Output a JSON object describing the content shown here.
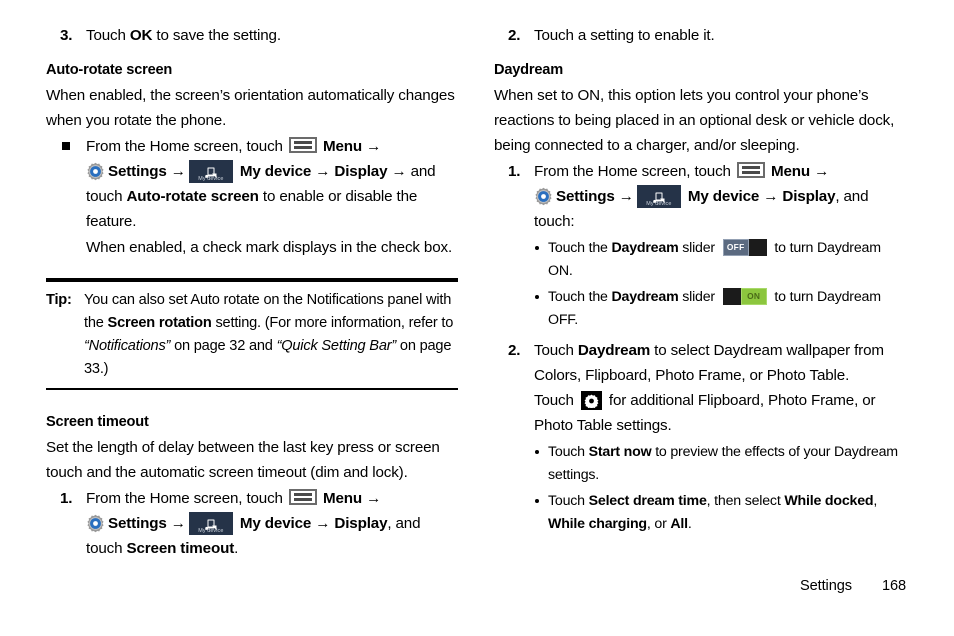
{
  "document": {
    "footer": {
      "section": "Settings",
      "page_number": "168"
    }
  },
  "left_column": {
    "step_ok": {
      "marker": "3.",
      "text_1": "Touch ",
      "bold_1": "OK",
      "text_2": " to save the setting."
    },
    "auto_rotate": {
      "heading": "Auto-rotate screen",
      "paragraph": "When enabled, the screen’s orientation automatically changes when you rotate the phone.",
      "step": {
        "marker": "■",
        "text_1": "From the Home screen, touch ",
        "menu_label": "Menu",
        "arrow": "→",
        "settings_label": "Settings",
        "mydevice_caption": "My device",
        "mydevice_label": "My device",
        "display_label": "Display",
        "text_and": " and",
        "text_touch": "touch ",
        "bold_auto": "Auto-rotate screen",
        "text_2": " to enable or disable the feature.",
        "note": "When enabled, a check mark displays in the check box."
      }
    },
    "tip": {
      "label": "Tip:",
      "text_1": "You can also set Auto rotate on the Notifications panel with the ",
      "bold_1": "Screen rotation",
      "text_2": " setting. (For more information, refer to ",
      "italic_1": "“Notifications”",
      "text_3": " on page 32 and ",
      "italic_2": "“Quick Setting Bar”",
      "text_4": " on page 33.)"
    },
    "screen_timeout": {
      "heading": "Screen timeout",
      "paragraph": "Set the length of delay between the last key press or screen touch and the automatic screen timeout (dim and lock).",
      "step": {
        "marker": "1.",
        "text_1": "From the Home screen, touch ",
        "menu_label": "Menu",
        "arrow": "→",
        "settings_label": "Settings",
        "mydevice_caption": "My device",
        "mydevice_label": "My device",
        "display_label": "Display",
        "text_and": ", and",
        "text_touch": "touch ",
        "bold_1": "Screen timeout",
        "text_2": "."
      }
    }
  },
  "right_column": {
    "step_enable": {
      "marker": "2.",
      "text": "Touch a setting to enable it."
    },
    "daydream": {
      "heading": "Daydream",
      "paragraph": "When set to ON, this option lets you control your phone’s reactions to being placed in an optional desk or vehicle dock, being connected to a charger, and/or sleeping.",
      "step1": {
        "marker": "1.",
        "text_1": "From the Home screen, touch ",
        "menu_label": "Menu",
        "arrow": "→",
        "settings_label": "Settings",
        "mydevice_caption": "My device",
        "mydevice_label": "My device",
        "display_label": "Display",
        "text_and": ", and",
        "text_touch": "touch:",
        "bullets": [
          {
            "text_1": "Touch the ",
            "bold_1": "Daydream",
            "text_2": " slider ",
            "toggle": "OFF",
            "toggle_state": "off",
            "text_3": " to turn Daydream ON."
          },
          {
            "text_1": "Touch the ",
            "bold_1": "Daydream",
            "text_2": " slider ",
            "toggle": "ON",
            "toggle_state": "on",
            "text_3": " to turn Daydream OFF."
          }
        ]
      },
      "step2": {
        "marker": "2.",
        "text_1": "Touch ",
        "bold_1": "Daydream",
        "text_2": " to select Daydream wallpaper from Colors, Flipboard, Photo Frame, or Photo Table.",
        "text_3": "Touch ",
        "text_4": " for additional Flipboard, Photo Frame, or Photo Table settings.",
        "bullets": [
          {
            "text_1": "Touch ",
            "bold_1": "Start now",
            "text_2": " to preview the effects of your Daydream settings."
          },
          {
            "text_1": "Touch ",
            "bold_1": "Select dream time",
            "text_2": ", then select ",
            "bold_2": "While docked",
            "text_3": ", ",
            "bold_3": "While charging",
            "text_4": ", or ",
            "bold_4": "All",
            "text_5": "."
          }
        ]
      }
    }
  },
  "colors": {
    "mydevice_tile": "#253348",
    "toggle_off": "#5b6a80",
    "toggle_on": "#8cc63e",
    "gear_blue": "#2a6fbf",
    "text": "#000000"
  }
}
